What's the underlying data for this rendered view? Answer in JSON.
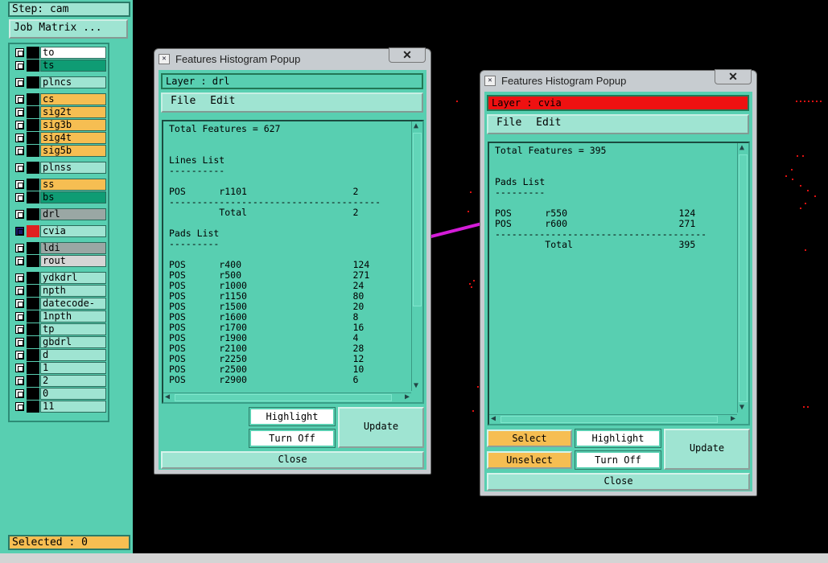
{
  "left_panel": {
    "step_label": "Step: cam",
    "job_matrix_label": "Job Matrix ...",
    "layers": [
      {
        "name": "to",
        "color": "white"
      },
      {
        "name": "ts",
        "color": "dteal"
      },
      {
        "name": "plncs",
        "color": "mint"
      },
      {
        "name": "cs",
        "color": "orange"
      },
      {
        "name": "sig2t",
        "color": "orange"
      },
      {
        "name": "sig3b",
        "color": "orange"
      },
      {
        "name": "sig4t",
        "color": "orange"
      },
      {
        "name": "sig5b",
        "color": "orange"
      },
      {
        "name": "plnss",
        "color": "mint"
      },
      {
        "name": "ss",
        "color": "orange"
      },
      {
        "name": "bs",
        "color": "dteal"
      },
      {
        "name": "drl",
        "color": "grey"
      },
      {
        "name": "cvia",
        "color": "mint"
      },
      {
        "name": "ldi",
        "color": "grey"
      },
      {
        "name": "rout",
        "color": "lgrey"
      },
      {
        "name": "ydkdrl",
        "color": "mint"
      },
      {
        "name": "npth",
        "color": "mint"
      },
      {
        "name": "datecode-ss",
        "color": "mint"
      },
      {
        "name": "1npth",
        "color": "mint"
      },
      {
        "name": "tp",
        "color": "mint"
      },
      {
        "name": "gbdrl",
        "color": "mint"
      },
      {
        "name": "d",
        "color": "mint"
      },
      {
        "name": "1",
        "color": "mint"
      },
      {
        "name": "2",
        "color": "mint"
      },
      {
        "name": "0",
        "color": "mint"
      },
      {
        "name": "11",
        "color": "mint"
      }
    ],
    "selected_label": "Selected : 0"
  },
  "popup1": {
    "title": "Features Histogram Popup",
    "close_x": "✕",
    "layer_label": "Layer :  drl",
    "menu": {
      "file": "File",
      "edit": "Edit"
    },
    "list_text": "Total Features = 627\n\n\nLines List\n----------\n\nPOS      r1101                   2\n--------------------------------------\n         Total                   2\n\nPads List\n---------\n\nPOS      r400                    124\nPOS      r500                    271\nPOS      r1000                   24\nPOS      r1150                   80\nPOS      r1500                   20\nPOS      r1600                   8\nPOS      r1700                   16\nPOS      r1900                   4\nPOS      r2100                   28\nPOS      r2250                   12\nPOS      r2500                   10\nPOS      r2900                   6",
    "buttons": {
      "highlight": "Highlight",
      "turn_off": "Turn Off",
      "update": "Update",
      "close": "Close"
    }
  },
  "popup2": {
    "title": "Features Histogram Popup",
    "close_x": "✕",
    "layer_label": "Layer :  cvia",
    "menu": {
      "file": "File",
      "edit": "Edit"
    },
    "list_text": "Total Features = 395\n\n\nPads List\n---------\n\nPOS      r550                    124\nPOS      r600                    271\n--------------------------------------\n         Total                   395",
    "buttons": {
      "select": "Select",
      "unselect": "Unselect",
      "highlight": "Highlight",
      "turn_off": "Turn Off",
      "update": "Update",
      "close": "Close"
    }
  },
  "colors": {
    "panel_teal": "#58cfb1",
    "field_mint": "#9fe4d2",
    "orange": "#f6be52",
    "dark_teal": "#0f9c74",
    "layer_red": "#ee1111",
    "annotation_arrow": "#d41cd8"
  }
}
